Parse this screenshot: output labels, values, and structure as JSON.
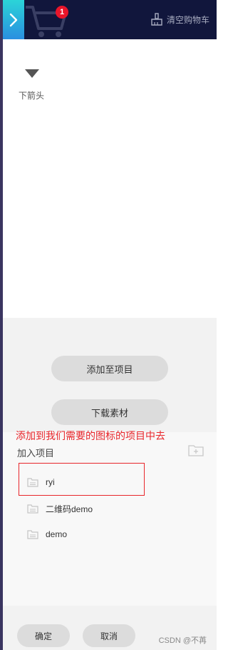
{
  "header": {
    "cart_count": "1",
    "clear_cart_label": "清空购物车"
  },
  "preview": {
    "icon_name": "下箭头"
  },
  "actions": {
    "add_to_project_label": "添加至项目",
    "download_label": "下载素材"
  },
  "annotation": {
    "text": "添加到我们需要的图标的项目中去",
    "color": "#e8262b"
  },
  "project": {
    "title": "加入项目",
    "items": [
      {
        "name": "ryi"
      },
      {
        "name": "二维码demo"
      },
      {
        "name": "demo"
      }
    ]
  },
  "footer": {
    "confirm_label": "确定",
    "cancel_label": "取消",
    "watermark": "CSDN @不苒"
  },
  "colors": {
    "header_bg": "#11163c",
    "accent": "#2bd4d8",
    "badge": "#e8152a",
    "button_bg": "#dcdcdc"
  }
}
